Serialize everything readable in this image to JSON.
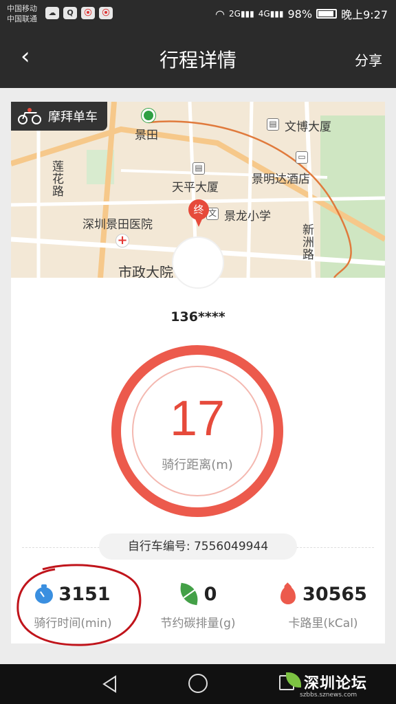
{
  "status_bar": {
    "carrier_1": "中国移动",
    "carrier_2": "中国联通",
    "battery": "98%",
    "time": "晚上9:27",
    "net_1": "2G",
    "net_2": "4G"
  },
  "header": {
    "title": "行程详情",
    "share_label": "分享"
  },
  "map": {
    "brand": "摩拜单车",
    "labels": {
      "metro_station": "景田",
      "museum": "文博大厦",
      "building": "天平大厦",
      "hotel": "景明达酒店",
      "hospital": "深圳景田医院",
      "school": "景龙小学",
      "road_left": "莲花路",
      "road_right": "新洲路",
      "bottom": "市政大院"
    },
    "end_marker": "终",
    "colors": {
      "land": "#f3e8d6",
      "road": "#ffffff",
      "major_road": "#f6c88a",
      "park": "#cfe6c2",
      "route": "#e07a3c"
    }
  },
  "user": {
    "name": "136****"
  },
  "ride": {
    "distance": "17",
    "distance_label": "骑行距离(m)",
    "bike_number": "自行车编号: 7556049944"
  },
  "stats": [
    {
      "icon": "timer-icon",
      "value": "3151",
      "label": "骑行时间(min)"
    },
    {
      "icon": "leaf-icon",
      "value": "0",
      "label": "节约碳排量(g)"
    },
    {
      "icon": "fire-icon",
      "value": "30565",
      "label": "卡路里(kCal)"
    }
  ],
  "watermark": {
    "name": "深圳论坛",
    "url": "szbbs.sznews.com"
  },
  "colors": {
    "accent": "#e64a3b",
    "ring": "#ec5a4c",
    "header": "#2b2b2b",
    "background": "#ececec"
  }
}
